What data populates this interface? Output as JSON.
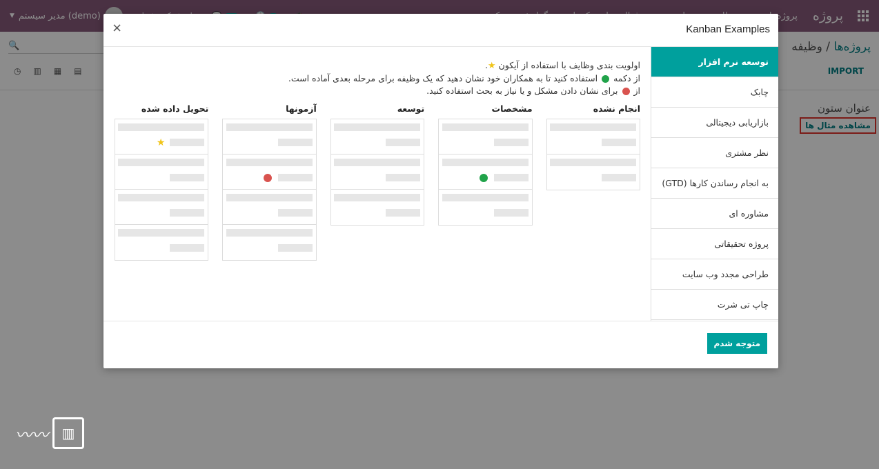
{
  "navbar": {
    "brand": "پروژه",
    "menu": [
      "پروژه‌ها",
      "همه وظایف",
      "برنامه‌ریزی",
      "فعالیت‌های حکمرانی",
      "گزارش",
      "پیکربندی"
    ],
    "user": "مدیر سیستم (demo)",
    "company": "نام شرکت شما",
    "badge_activities": "1",
    "badge_messages": "10"
  },
  "control_panel": {
    "breadcrumb_parent": "پروژه‌ها",
    "breadcrumb_sep": "/",
    "breadcrumb_current": "وظیفه",
    "import_label": "IMPORT",
    "column_title": "عنوان ستون",
    "see_examples": "مشاهده مثال ها"
  },
  "modal": {
    "title": "Kanban Examples",
    "close": "×",
    "ok_label": "متوجه شدم",
    "examples": [
      "توسعه نرم افزار",
      "چابک",
      "بازاریابی دیجیتالی",
      "نظر مشتری",
      "به انجام رساندن کارها (GTD)",
      "مشاوره ای",
      "پروژه تحقیقاتی",
      "طراحی مجدد وب سایت",
      "چاپ تی شرت"
    ],
    "description": {
      "line1_a": "اولویت بندی وظایف با استفاده از آیکون",
      "line1_b": ".",
      "line2_a": "از دکمه",
      "line2_b": "استفاده کنید تا به همکاران خود نشان دهید که یک وظیفه برای مرحله بعدی آماده است.",
      "line3_a": "از",
      "line3_b": "برای نشان دادن مشکل و یا نیاز به بحث استفاده کنید."
    },
    "columns": [
      {
        "title": "انجام نشده",
        "cards": 2,
        "mark_card": -1,
        "mark": ""
      },
      {
        "title": "مشخصات",
        "cards": 3,
        "mark_card": 1,
        "mark": "green"
      },
      {
        "title": "توسعه",
        "cards": 3,
        "mark_card": -1,
        "mark": ""
      },
      {
        "title": "آزمونها",
        "cards": 4,
        "mark_card": 1,
        "mark": "red"
      },
      {
        "title": "تحویل داده شده",
        "cards": 4,
        "mark_card": 0,
        "mark": "star"
      }
    ]
  },
  "colors": {
    "navbar": "#875a7b",
    "primary": "#00a09d",
    "green": "#21a34a",
    "red": "#d9534f",
    "star": "#f0c419"
  }
}
